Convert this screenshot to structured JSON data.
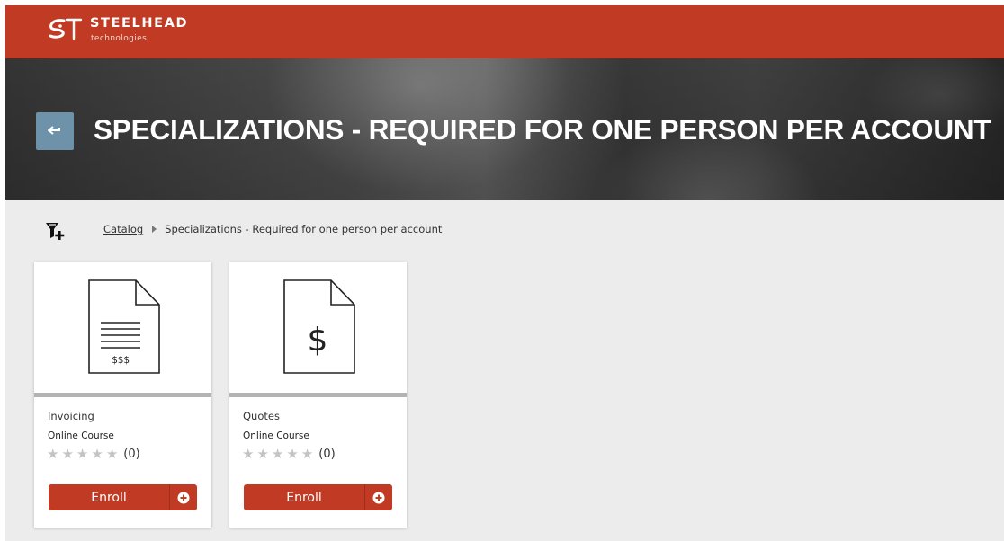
{
  "brand": {
    "name": "STEELHEAD",
    "sub": "technologies",
    "color": "#c13a23"
  },
  "hero": {
    "title": "SPECIALIZATIONS - REQUIRED FOR ONE PERSON PER ACCOUNT",
    "back_icon": "back-arrow-icon",
    "back_button_color": "#6d92a9"
  },
  "breadcrumb": {
    "filter_icon": "filter-add-icon",
    "items": [
      {
        "label": "Catalog",
        "link": true
      },
      {
        "label": "Specializations - Required for one person per account",
        "link": false
      }
    ]
  },
  "cards": [
    {
      "title": "Invoicing",
      "type": "Online Course",
      "icon": "invoice-document-icon",
      "icon_text": "$$$",
      "rating": 0,
      "rating_count": "(0)",
      "enroll_label": "Enroll"
    },
    {
      "title": "Quotes",
      "type": "Online Course",
      "icon": "quote-document-icon",
      "icon_text": "$",
      "rating": 0,
      "rating_count": "(0)",
      "enroll_label": "Enroll"
    }
  ]
}
